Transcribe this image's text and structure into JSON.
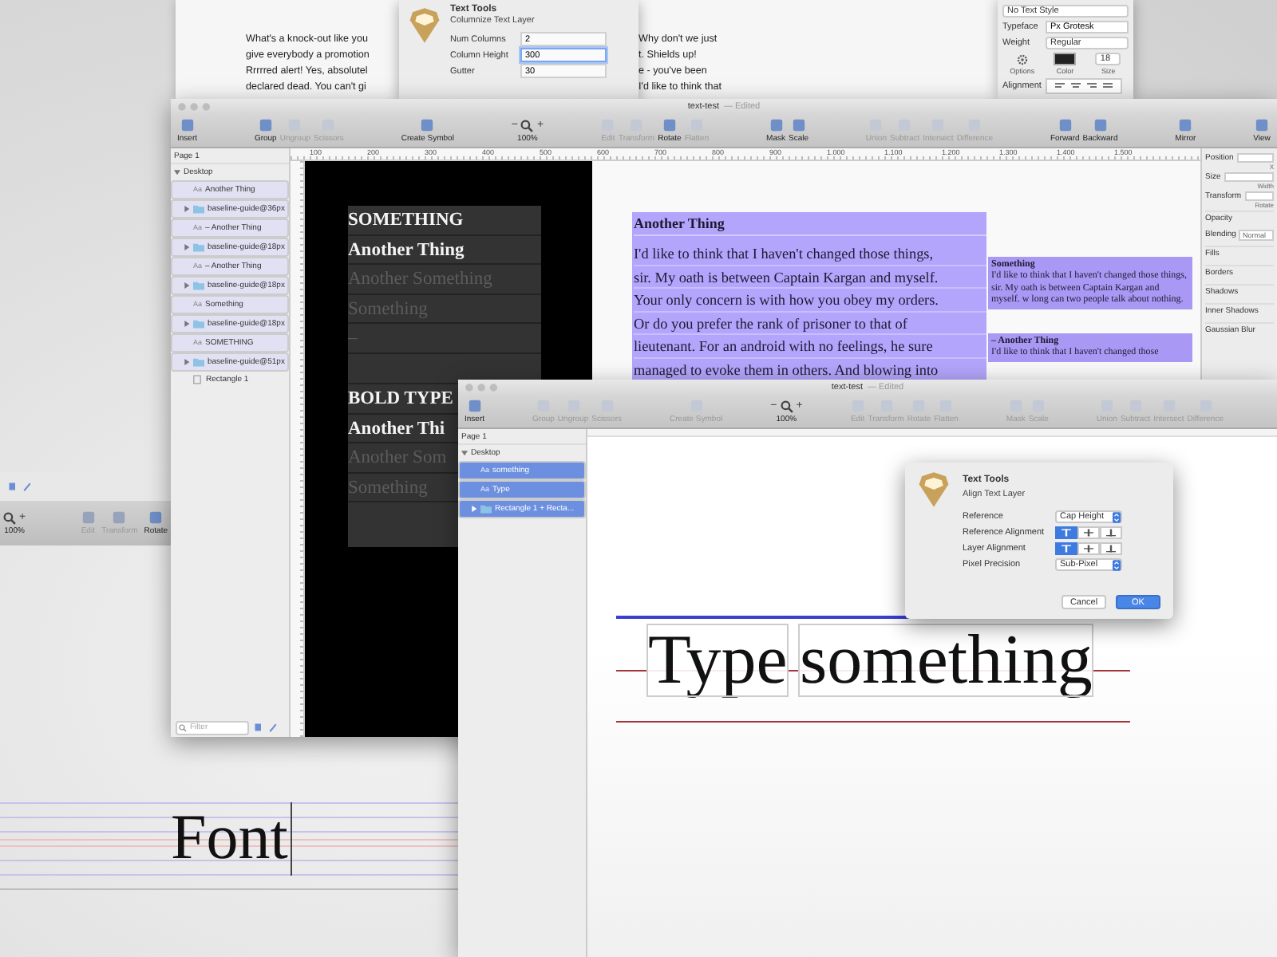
{
  "back_document": {
    "left_lines": [
      "What's a knock-out like you",
      "give everybody a promotion",
      "Rrrrred alert! Yes, absolutel",
      "declared dead. You can't gi"
    ],
    "right_lines": [
      "Why don't we just",
      "t. Shields up!",
      "e - you've been",
      "I'd like to think that"
    ]
  },
  "columnize_dialog": {
    "title": "Text Tools",
    "subtitle": "Columnize Text Layer",
    "fields": [
      {
        "label": "Num Columns",
        "value": "2",
        "focused": false
      },
      {
        "label": "Column Height",
        "value": "300",
        "focused": true
      },
      {
        "label": "Gutter",
        "value": "30",
        "focused": false
      }
    ]
  },
  "text_style_panel": {
    "style": "No Text Style",
    "typeface_label": "Typeface",
    "typeface": "Px Grotesk",
    "weight_label": "Weight",
    "weight": "Regular",
    "options_label": "Options",
    "color_label": "Color",
    "size": "18",
    "size_label": "Size",
    "alignment_label": "Alignment"
  },
  "back_toolbar": [
    {
      "kind": "zoom",
      "label": "100%",
      "plus": "+"
    },
    {
      "kind": "button",
      "label": "Edit",
      "disabled": true
    },
    {
      "kind": "button",
      "label": "Transform",
      "disabled": true
    },
    {
      "kind": "button",
      "label": "Rotate",
      "disabled": false
    }
  ],
  "main_window": {
    "title": "text-test",
    "status": "— Edited",
    "toolbar": [
      [
        {
          "kind": "button",
          "label": "Insert",
          "disabled": false
        }
      ],
      [
        {
          "kind": "button",
          "label": "Group",
          "disabled": false
        },
        {
          "kind": "button",
          "label": "Ungroup",
          "disabled": true
        },
        {
          "kind": "button",
          "label": "Scissors",
          "disabled": true
        }
      ],
      [
        {
          "kind": "button",
          "label": "Create Symbol",
          "disabled": false
        }
      ],
      [
        {
          "kind": "zoom",
          "label": "100%",
          "minus": "−",
          "plus": "+"
        }
      ],
      [
        {
          "kind": "button",
          "label": "Edit",
          "disabled": true
        },
        {
          "kind": "button",
          "label": "Transform",
          "disabled": true
        },
        {
          "kind": "button",
          "label": "Rotate",
          "disabled": false
        },
        {
          "kind": "button",
          "label": "Flatten",
          "disabled": true
        }
      ],
      [
        {
          "kind": "button",
          "label": "Mask",
          "disabled": false
        },
        {
          "kind": "button",
          "label": "Scale",
          "disabled": false
        }
      ],
      [
        {
          "kind": "button",
          "label": "Union",
          "disabled": true
        },
        {
          "kind": "button",
          "label": "Subtract",
          "disabled": true
        },
        {
          "kind": "button",
          "label": "Intersect",
          "disabled": true
        },
        {
          "kind": "button",
          "label": "Difference",
          "disabled": true
        }
      ],
      [
        {
          "kind": "button",
          "label": "Forward",
          "disabled": false
        },
        {
          "kind": "button",
          "label": "Backward",
          "disabled": false
        }
      ],
      [
        {
          "kind": "button",
          "label": "Mirror",
          "disabled": false
        }
      ],
      [
        {
          "kind": "button",
          "label": "View",
          "disabled": false
        }
      ]
    ],
    "page": "Page 1",
    "layers": [
      {
        "kind": "artboard",
        "name": "Desktop",
        "expanded": true,
        "selected": false,
        "children": [
          {
            "kind": "text",
            "glyph": "Aa",
            "name": "Another Thing",
            "selected": true
          },
          {
            "kind": "group",
            "name": "baseline-guide@36px",
            "expanded": false,
            "selected": true
          },
          {
            "kind": "text",
            "glyph": "Aa",
            "name": "– Another Thing",
            "selected": true
          },
          {
            "kind": "group",
            "name": "baseline-guide@18px",
            "expanded": false,
            "selected": true
          },
          {
            "kind": "text",
            "glyph": "Aa",
            "name": "– Another Thing",
            "selected": true
          },
          {
            "kind": "group",
            "name": "baseline-guide@18px",
            "expanded": false,
            "selected": true
          },
          {
            "kind": "text",
            "glyph": "Aa",
            "name": "Something",
            "selected": true
          },
          {
            "kind": "group",
            "name": "baseline-guide@18px",
            "expanded": false,
            "selected": true
          },
          {
            "kind": "text",
            "glyph": "Aa",
            "name": "SOMETHING",
            "selected": true
          },
          {
            "kind": "group",
            "name": "baseline-guide@51px",
            "expanded": false,
            "selected": true
          },
          {
            "kind": "shape",
            "name": "Rectangle 1",
            "selected": false
          }
        ]
      }
    ],
    "filter_placeholder": "Filter",
    "ruler": [
      "100",
      "200",
      "300",
      "400",
      "500",
      "600",
      "700",
      "800",
      "900",
      "1.000",
      "1.100",
      "1.200",
      "1.300",
      "1.400",
      "1.500"
    ],
    "artboard_lines": [
      {
        "kind": "text",
        "text": "SOMETHING",
        "muted": false
      },
      {
        "kind": "text",
        "text": "Another Thing",
        "muted": false
      },
      {
        "kind": "text",
        "text": "Another Something",
        "muted": true
      },
      {
        "kind": "text",
        "text": "Something",
        "muted": true
      },
      {
        "kind": "text",
        "text": "–",
        "muted": true
      },
      {
        "kind": "gap"
      },
      {
        "kind": "text",
        "text": "BOLD TYPE",
        "muted": false
      },
      {
        "kind": "text",
        "text": "Another Thi",
        "muted": false
      },
      {
        "kind": "text",
        "text": "Another Som",
        "muted": true
      },
      {
        "kind": "text",
        "text": "Something",
        "muted": true
      }
    ],
    "text_block": {
      "heading": "Another Thing",
      "lines": [
        "I'd like to think that I haven't changed those things,",
        "sir. My oath is between Captain Kargan and myself.",
        "Your only concern is with how you obey my orders.",
        "Or do you prefer the rank of prisoner to that of",
        "lieutenant. For an android with no feelings, he sure",
        "managed to evoke them in others. And blowing into"
      ]
    },
    "small_blocks": [
      {
        "heading": "Something",
        "text": "I'd like to think that I haven't changed those things, sir. My oath is between Captain Kargan and myself. w long can two people talk about nothing."
      },
      {
        "heading": "– Another Thing",
        "text": "I'd like to think that I haven't changed those"
      }
    ],
    "inspector": [
      {
        "kind": "field",
        "label": "Position",
        "sub": "X"
      },
      {
        "kind": "field",
        "label": "Size",
        "sub": "Width"
      },
      {
        "kind": "field",
        "label": "Transform",
        "sub": "Rotate"
      },
      {
        "kind": "plain",
        "label": "Opacity"
      },
      {
        "kind": "select",
        "label": "Blending",
        "value": "Normal"
      },
      {
        "kind": "plain",
        "label": "Fills"
      },
      {
        "kind": "plain",
        "label": "Borders"
      },
      {
        "kind": "plain",
        "label": "Shadows"
      },
      {
        "kind": "plain",
        "label": "Inner Shadows"
      },
      {
        "kind": "plain",
        "label": "Gaussian Blur"
      }
    ]
  },
  "front_window": {
    "title": "text-test",
    "status": "— Edited",
    "toolbar": [
      [
        {
          "kind": "button",
          "label": "Insert",
          "disabled": false
        }
      ],
      [
        {
          "kind": "button",
          "label": "Group",
          "disabled": true
        },
        {
          "kind": "button",
          "label": "Ungroup",
          "disabled": true
        },
        {
          "kind": "button",
          "label": "Scissors",
          "disabled": true
        }
      ],
      [
        {
          "kind": "button",
          "label": "Create Symbol",
          "disabled": true
        }
      ],
      [
        {
          "kind": "zoom",
          "label": "100%",
          "minus": "−",
          "plus": "+"
        }
      ],
      [
        {
          "kind": "button",
          "label": "Edit",
          "disabled": true
        },
        {
          "kind": "button",
          "label": "Transform",
          "disabled": true
        },
        {
          "kind": "button",
          "label": "Rotate",
          "disabled": true
        },
        {
          "kind": "button",
          "label": "Flatten",
          "disabled": true
        }
      ],
      [
        {
          "kind": "button",
          "label": "Mask",
          "disabled": true
        },
        {
          "kind": "button",
          "label": "Scale",
          "disabled": true
        }
      ],
      [
        {
          "kind": "button",
          "label": "Union",
          "disabled": true
        },
        {
          "kind": "button",
          "label": "Subtract",
          "disabled": true
        },
        {
          "kind": "button",
          "label": "Intersect",
          "disabled": true
        },
        {
          "kind": "button",
          "label": "Difference",
          "disabled": true
        }
      ]
    ],
    "page": "Page 1",
    "layers": [
      {
        "kind": "artboard",
        "name": "Desktop",
        "expanded": true,
        "selected": false,
        "children": [
          {
            "kind": "text",
            "glyph": "Aa",
            "name": "something",
            "selected": true
          },
          {
            "kind": "text",
            "glyph": "Aa",
            "name": "Type",
            "selected": true
          },
          {
            "kind": "group",
            "name": "Rectangle 1 + Recta...",
            "expanded": false,
            "selected": true
          }
        ]
      }
    ],
    "canvas_words": [
      "Type",
      "something"
    ]
  },
  "align_dialog": {
    "title": "Text Tools",
    "subtitle": "Align Text Layer",
    "rows": [
      {
        "kind": "select",
        "label": "Reference",
        "value": "Cap Height"
      },
      {
        "kind": "segments",
        "label": "Reference Alignment",
        "segments": [
          {
            "selected": true
          },
          {
            "selected": false
          },
          {
            "selected": false
          }
        ]
      },
      {
        "kind": "segments",
        "label": "Layer Alignment",
        "segments": [
          {
            "selected": true
          },
          {
            "selected": false
          },
          {
            "selected": false
          }
        ]
      },
      {
        "kind": "select",
        "label": "Pixel Precision",
        "value": "Sub-Pixel"
      }
    ],
    "buttons": [
      {
        "label": "Cancel",
        "default": false
      },
      {
        "label": "OK",
        "default": true
      }
    ]
  },
  "font_sample": "Font"
}
